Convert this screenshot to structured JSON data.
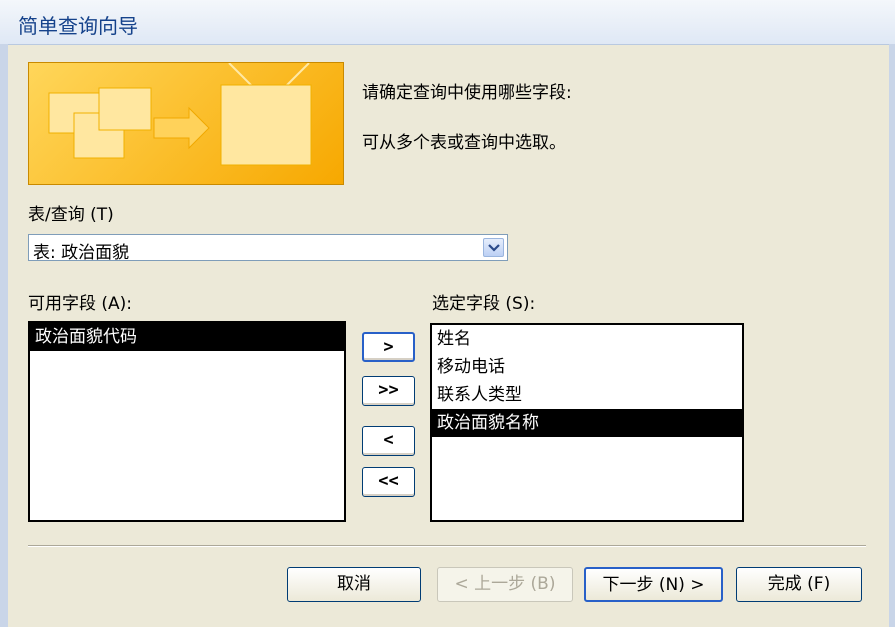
{
  "window": {
    "title": "简单查询向导"
  },
  "description": {
    "line1": "请确定查询中使用哪些字段:",
    "line2": "可从多个表或查询中选取。"
  },
  "table_query": {
    "label": "表/查询 (T)",
    "selected": "表: 政治面貌"
  },
  "available_fields": {
    "label": "可用字段 (A):",
    "items": [
      "政治面貌代码"
    ],
    "selected_index": 0
  },
  "selected_fields": {
    "label": "选定字段 (S):",
    "items": [
      "姓名",
      "移动电话",
      "联系人类型",
      "政治面貌名称"
    ],
    "selected_index": 3
  },
  "move_buttons": {
    "add_one": ">",
    "add_all": ">>",
    "remove_one": "<",
    "remove_all": "<<"
  },
  "footer": {
    "cancel": "取消",
    "back": "< 上一步 (B)",
    "next": "下一步 (N) >",
    "finish": "完成 (F)"
  },
  "colors": {
    "banner_orange": "#f7a800",
    "title_text": "#15428b",
    "dialog_bg": "#ece9d8"
  }
}
